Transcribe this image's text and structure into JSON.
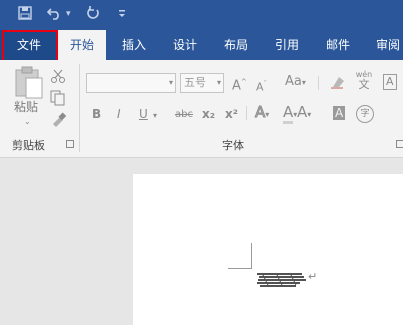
{
  "quick_access": {
    "save_icon": "save-icon",
    "undo_icon": "undo-icon",
    "undo_dropdown": "▾",
    "redo_icon": "redo-icon",
    "customize_icon": "customize-qat-icon"
  },
  "tabs": [
    {
      "label": "文件"
    },
    {
      "label": "开始"
    },
    {
      "label": "插入"
    },
    {
      "label": "设计"
    },
    {
      "label": "布局"
    },
    {
      "label": "引用"
    },
    {
      "label": "邮件"
    },
    {
      "label": "审阅"
    }
  ],
  "clipboard": {
    "paste_label": "粘贴",
    "group_label": "剪贴板"
  },
  "font": {
    "font_name_value": "",
    "font_size_value": "五号",
    "grow_label": "A",
    "shrink_label": "A",
    "case_label": "Aa",
    "bold_label": "B",
    "italic_label": "I",
    "underline_label": "U",
    "strike_label": "abc",
    "subscript_label": "x₂",
    "superscript_label": "x²",
    "effects_label": "A",
    "highlight_label": "A",
    "color_label": "A",
    "charshade_label": "A",
    "enclose_label": "字",
    "phonetic_top": "wén",
    "phonetic_bottom": "文",
    "border_label": "A",
    "group_label": "字体"
  },
  "colors": {
    "title_bar": "#2b579a",
    "highlight_box": "#e60012"
  }
}
